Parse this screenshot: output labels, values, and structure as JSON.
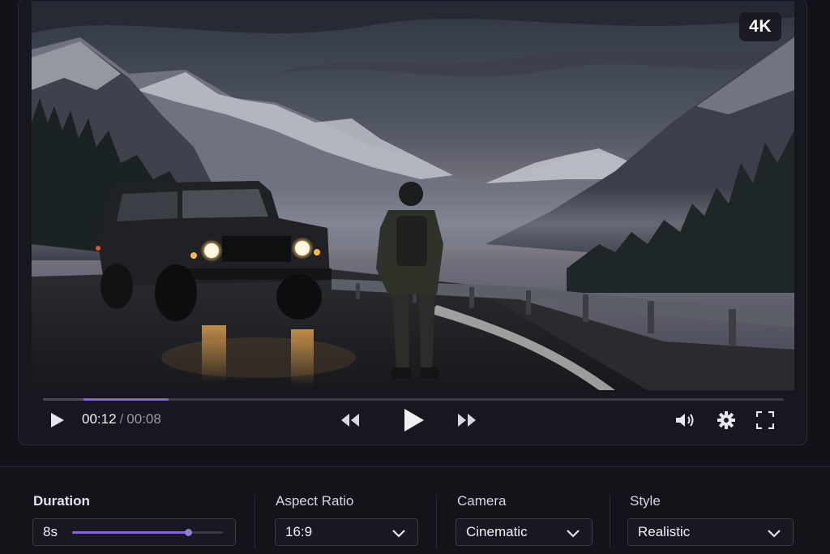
{
  "player": {
    "quality_badge": "4K",
    "current_time": "00:12",
    "separator": "/",
    "duration_time": "00:08",
    "progress_fraction": 0.17,
    "progress_buffered_fraction": 0.055,
    "icons": {
      "play_small": "play-icon",
      "rewind": "rewind-icon",
      "play_main": "play-icon",
      "forward": "fast-forward-icon",
      "volume": "volume-icon",
      "settings": "gear-icon",
      "fullscreen": "fullscreen-icon"
    }
  },
  "settings": {
    "duration": {
      "label": "Duration",
      "value": "8s",
      "slider_fraction": 0.77
    },
    "aspect_ratio": {
      "label": "Aspect Ratio",
      "value": "16:9"
    },
    "camera": {
      "label": "Camera",
      "value": "Cinematic"
    },
    "style": {
      "label": "Style",
      "value": "Realistic"
    }
  },
  "colors": {
    "accent": "#8b5cf6",
    "background": "#121218",
    "card": "#17171f"
  }
}
